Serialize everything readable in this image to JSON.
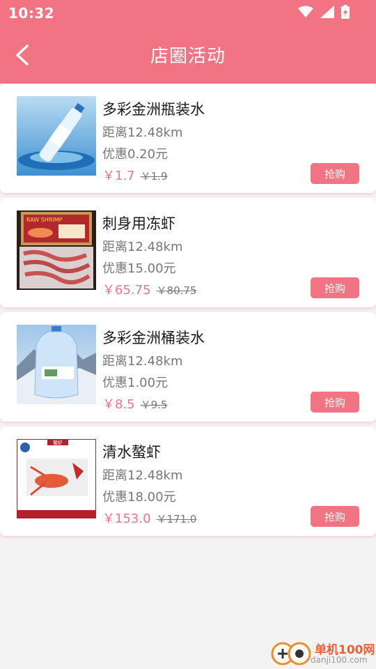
{
  "status": {
    "time": "10:32"
  },
  "header": {
    "title": "店圈活动"
  },
  "products": [
    {
      "name": "多彩金洲瓶装水",
      "distance": "距离12.48km",
      "discount": "优惠0.20元",
      "price": "￥1.7",
      "original_price": "￥1.9",
      "button": "抢购"
    },
    {
      "name": "刺身用冻虾",
      "distance": "距离12.48km",
      "discount": "优惠15.00元",
      "price": "￥65.75",
      "original_price": "￥80.75",
      "button": "抢购",
      "image_text": "RAW SHRIMP"
    },
    {
      "name": "多彩金洲桶装水",
      "distance": "距离12.48km",
      "discount": "优惠1.00元",
      "price": "￥8.5",
      "original_price": "￥9.5",
      "button": "抢购"
    },
    {
      "name": "清水螯虾",
      "distance": "距离12.48km",
      "discount": "优惠18.00元",
      "price": "￥153.0",
      "original_price": "￥171.0",
      "button": "抢购",
      "image_text": "螯虾"
    }
  ],
  "watermark": {
    "line1": "单机100网",
    "line2": "danji100.com"
  },
  "colors": {
    "accent": "#f27381",
    "background": "#f4f3f4"
  }
}
